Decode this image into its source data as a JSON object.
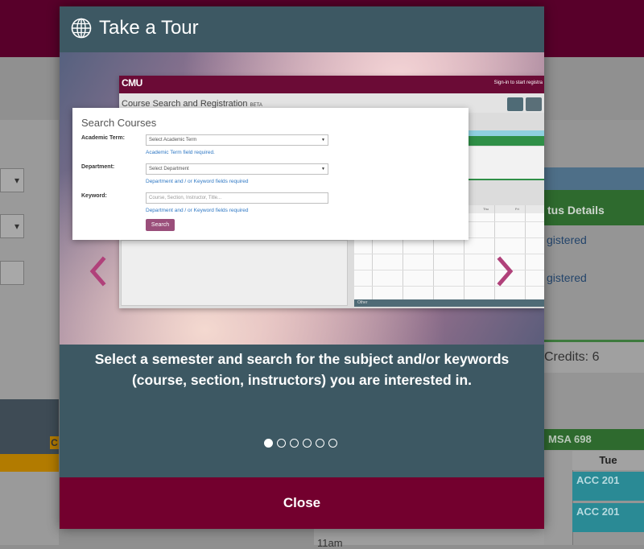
{
  "modal": {
    "title": "Take a Tour",
    "caption": "Select a semester and search for the subject and/or keywords (course, section, instructors) you are interested in.",
    "close_label": "Close",
    "slide_count": 6,
    "active_slide": 1,
    "icons": {
      "title": "globe-icon",
      "prev": "chevron-left-icon",
      "next": "chevron-right-icon"
    },
    "colors": {
      "header": "#3d5863",
      "footer": "#73002e",
      "accent": "#9a4e7a"
    }
  },
  "slide": {
    "logo": "CMU",
    "signin": "Sign-in to start registra",
    "app_title": "Course Search and Registration",
    "app_badge": "BETA",
    "calendar_days": [
      "Wed",
      "Thu",
      "Fri"
    ],
    "calendar_other": "Other",
    "popup": {
      "title": "Search Courses",
      "term_label": "Academic Term:",
      "term_placeholder": "Select Academic Term",
      "term_hint": "Academic Term field required.",
      "dept_label": "Department:",
      "dept_placeholder": "Select Department",
      "dept_hint": "Department and / or Keyword fields required",
      "keyword_label": "Keyword:",
      "keyword_placeholder": "Course, Section, Instructor, Title...",
      "keyword_hint": "Department and / or Keyword fields required",
      "search_label": "Search"
    }
  },
  "background": {
    "status_details": "tus Details",
    "registered_1": "gistered",
    "registered_2": "gistered",
    "credits": "Credits: 6",
    "course_header": "MSA 698",
    "day_header": "Tue",
    "course_1": "ACC 201",
    "course_2": "ACC 201",
    "time": "11am",
    "badge": "C"
  }
}
